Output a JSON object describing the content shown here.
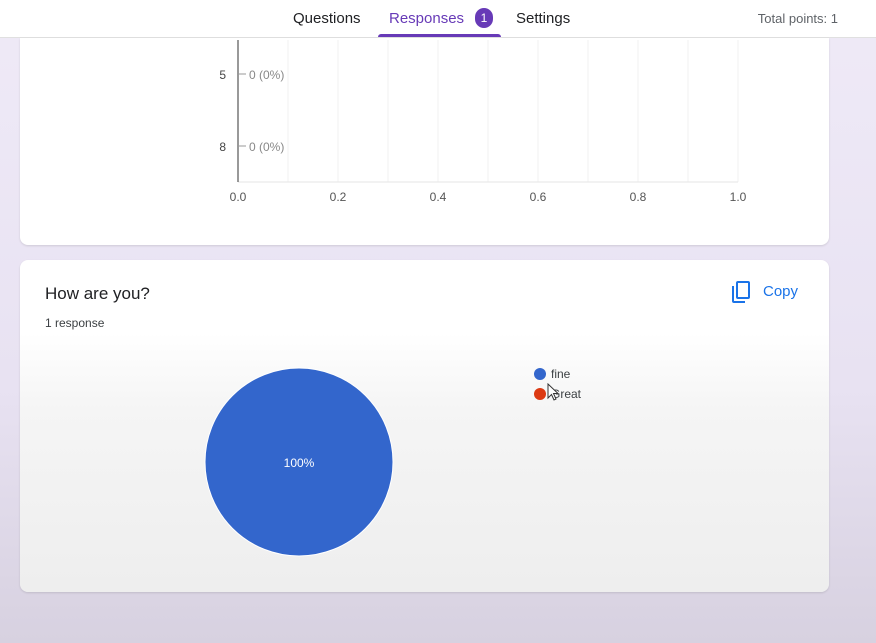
{
  "tabs": {
    "questions": "Questions",
    "responses": "Responses",
    "responses_count": "1",
    "settings": "Settings"
  },
  "total_points": "Total points: 1",
  "bar_chart_partial": {
    "rows": [
      {
        "label": "5",
        "value_label": "0 (0%)"
      },
      {
        "label": "8",
        "value_label": "0 (0%)"
      }
    ],
    "x_ticks": [
      "0.0",
      "0.2",
      "0.4",
      "0.6",
      "0.8",
      "1.0"
    ]
  },
  "question": {
    "title": "How are you?",
    "response_count": "1 response",
    "copy_label": "Copy"
  },
  "chart_data": {
    "type": "pie",
    "slices": [
      {
        "label": "fine",
        "value": 100,
        "color": "#3366cc"
      },
      {
        "label": "Great",
        "value": 0,
        "color": "#dc3912"
      }
    ],
    "slice_label": "100%"
  },
  "colors": {
    "accent": "#673ab7",
    "copy_blue": "#1a73e8"
  }
}
